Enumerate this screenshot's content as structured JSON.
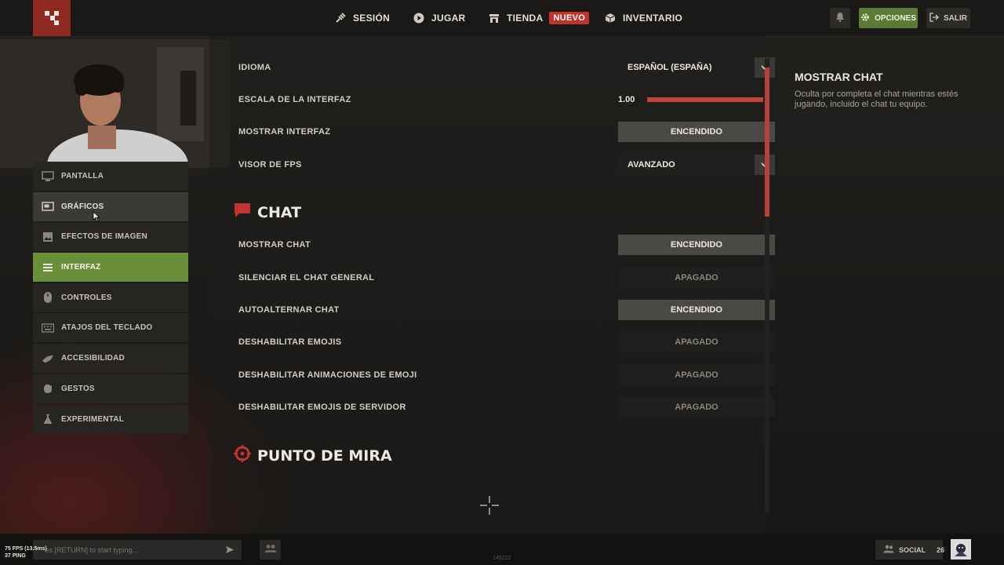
{
  "nav": {
    "session_label": "SESIÓN",
    "play_label": "JUGAR",
    "store_label": "TIENDA",
    "store_badge": "NUEVO",
    "inventory_label": "INVENTARIO",
    "options_label": "OPCIONES",
    "exit_label": "SALIR"
  },
  "sidebar": {
    "items": [
      {
        "label": "PANTALLA",
        "icon": "monitor-icon"
      },
      {
        "label": "GRÁFICOS",
        "icon": "graphics-icon"
      },
      {
        "label": "EFECTOS DE IMAGEN",
        "icon": "image-icon"
      },
      {
        "label": "INTERFAZ",
        "icon": "list-icon"
      },
      {
        "label": "CONTROLES",
        "icon": "mouse-icon"
      },
      {
        "label": "ATAJOS DEL TECLADO",
        "icon": "keyboard-icon"
      },
      {
        "label": "ACCESIBILIDAD",
        "icon": "accessibility-icon"
      },
      {
        "label": "GESTOS",
        "icon": "gesture-icon"
      },
      {
        "label": "EXPERIMENTAL",
        "icon": "flask-icon"
      }
    ],
    "active": "INTERFAZ",
    "hovered": "GRÁFICOS"
  },
  "settings": {
    "language": {
      "label": "IDIOMA",
      "value": "ESPAÑOL (ESPAÑA)"
    },
    "ui_scale": {
      "label": "ESCALA DE LA INTERFAZ",
      "value": "1.00",
      "level": 1.0
    },
    "show_ui": {
      "label": "MOSTRAR INTERFAZ",
      "value": "ENCENDIDO"
    },
    "fps_display": {
      "label": "VISOR DE FPS",
      "value": "AVANZADO"
    }
  },
  "chat_section": {
    "title": "CHAT",
    "rows": [
      {
        "label": "MOSTRAR CHAT",
        "value": "ENCENDIDO",
        "on": true
      },
      {
        "label": "SILENCIAR EL CHAT GENERAL",
        "value": "APAGADO",
        "on": false
      },
      {
        "label": "AUTOALTERNAR CHAT",
        "value": "ENCENDIDO",
        "on": true
      },
      {
        "label": "DESHABILITAR EMOJIS",
        "value": "APAGADO",
        "on": false
      },
      {
        "label": "DESHABILITAR ANIMACIONES DE EMOJI",
        "value": "APAGADO",
        "on": false
      },
      {
        "label": "DESHABILITAR EMOJIS DE SERVIDOR",
        "value": "APAGADO",
        "on": false
      }
    ]
  },
  "crosshair_section": {
    "title": "PUNTO DE MIRA"
  },
  "info_panel": {
    "title": "MOSTRAR CHAT",
    "description": "Oculta por completa el chat mientras estés jugando, incluido el chat tu equipo."
  },
  "bottom": {
    "chat_placeholder": "ss [RETURN] to start typing...",
    "fps_text": "75 FPS (13.5ms)",
    "ping_text": "37 PING",
    "build_code": "145222",
    "social_label": "SOCIAL",
    "social_count": "26"
  },
  "colors": {
    "accent_green": "#6b8e3a",
    "accent_red": "#c0453c",
    "logo_red": "#8e2a22"
  }
}
